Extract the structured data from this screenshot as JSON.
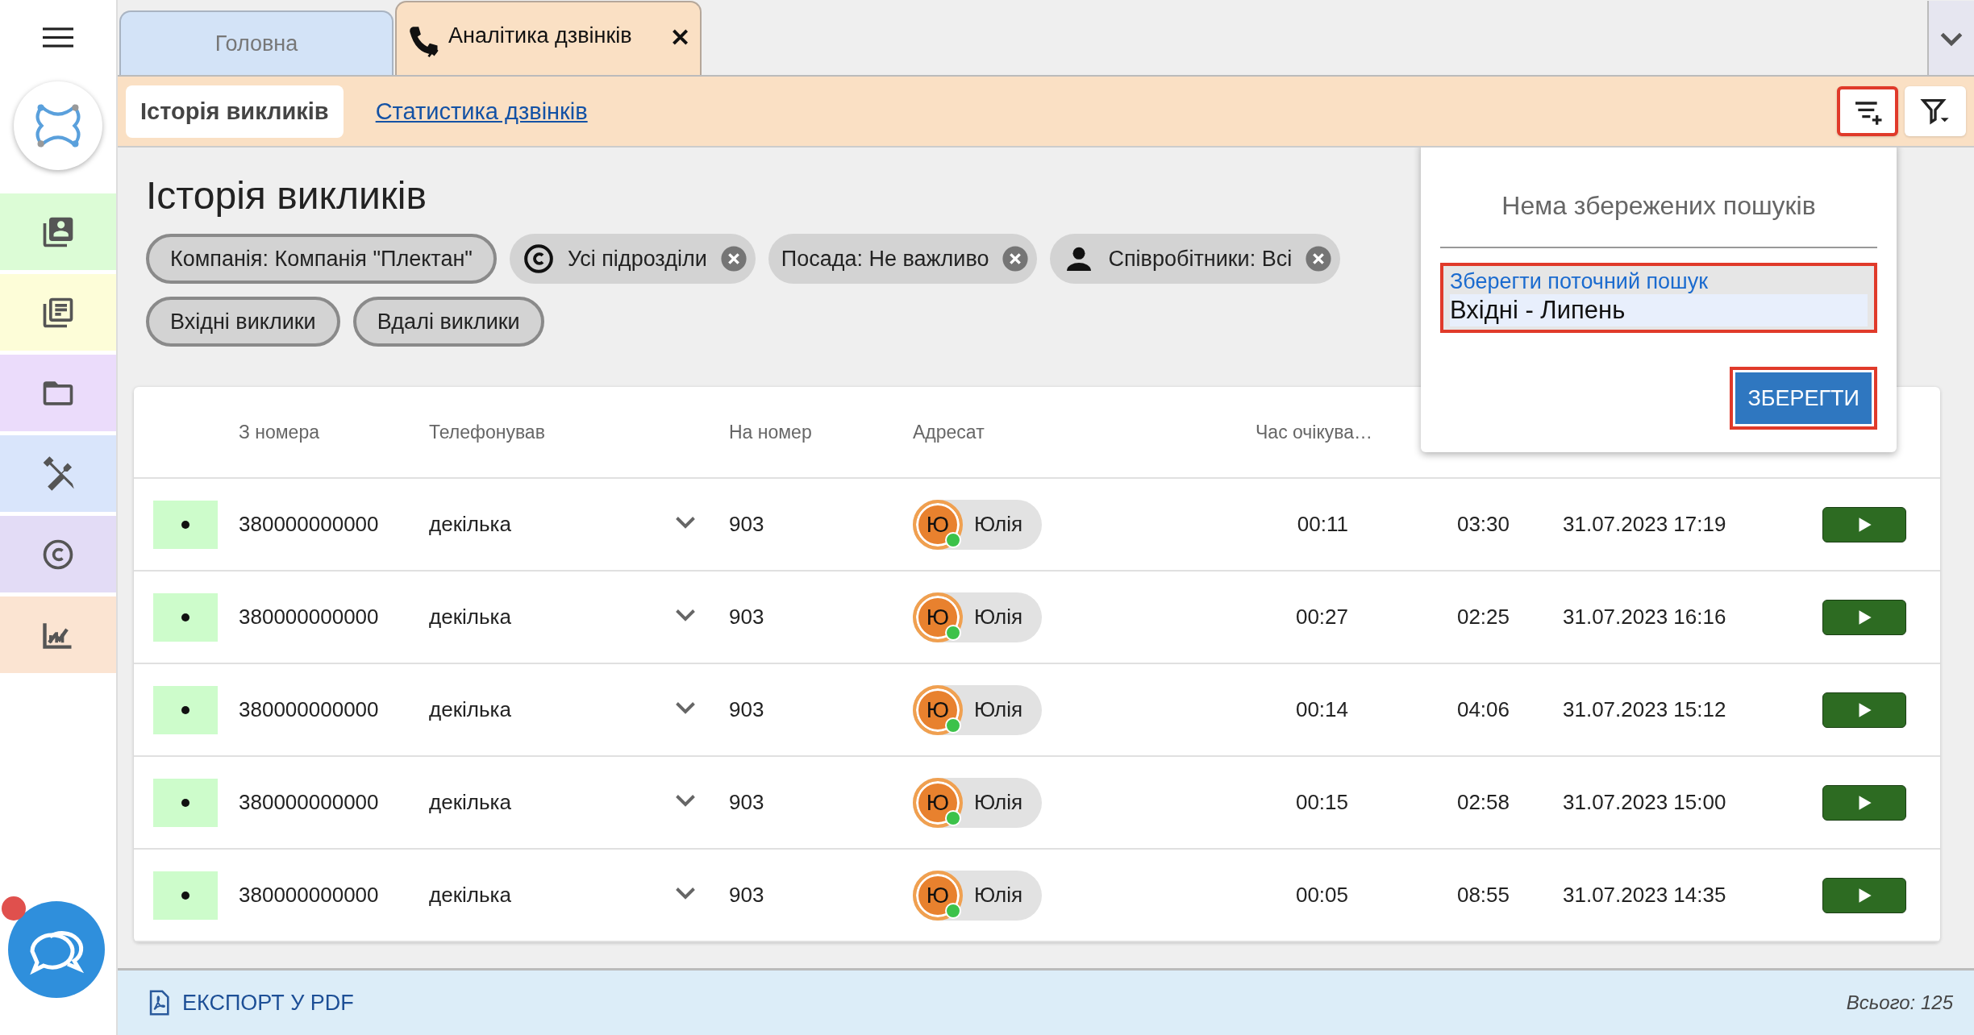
{
  "sidebar": {
    "items": [
      {
        "kind": "contacts",
        "color": "#dcfcd6"
      },
      {
        "kind": "news",
        "color": "#fdfdd8"
      },
      {
        "kind": "folder",
        "color": "#ebdcfb"
      },
      {
        "kind": "tools",
        "color": "#d9e5fb"
      },
      {
        "kind": "copyright",
        "color": "#e3dcf6"
      },
      {
        "kind": "chart",
        "color": "#fbe4d2"
      }
    ],
    "chat": {
      "unread": true
    }
  },
  "tabs": [
    {
      "label": "Головна",
      "selected": false,
      "closable": false
    },
    {
      "label": "Аналітика дзвінків",
      "selected": true,
      "closable": true,
      "close": "✕"
    }
  ],
  "subtabs": [
    {
      "label": "Історія викликів",
      "selected": true
    },
    {
      "label": "Статистика дзвінків",
      "selected": false
    }
  ],
  "toolbar": [
    {
      "kind": "add",
      "highlighted": true
    },
    {
      "kind": "menu",
      "highlighted": false
    }
  ],
  "title": "Історія викликів",
  "filters": [
    {
      "label": "Компанія: Компанія \"Плектан\"",
      "kind": "plain",
      "removable": false
    },
    {
      "label": "Усі підрозділи",
      "kind": "copyright",
      "removable": true
    },
    {
      "label": "Посада: Не важливо",
      "kind": "plain",
      "removable": true
    },
    {
      "label": "Співробітники: Всі",
      "kind": "person",
      "removable": true
    },
    {
      "label": "Вхідні виклики",
      "kind": "plain",
      "removable": false
    },
    {
      "label": "Вдалі виклики",
      "kind": "plain",
      "removable": false
    }
  ],
  "table": {
    "columns": [
      "З номера",
      "Телефонував",
      "На номер",
      "Адресат",
      "Час очікува…"
    ],
    "rows": [
      {
        "from": "380000000000",
        "caller": "декілька",
        "to": "903",
        "initial": "Ю",
        "addressee": "Юлія",
        "online": true,
        "wait": "00:11",
        "duration": "03:30",
        "date": "31.07.2023 17:19"
      },
      {
        "from": "380000000000",
        "caller": "декілька",
        "to": "903",
        "initial": "Ю",
        "addressee": "Юлія",
        "online": true,
        "wait": "00:27",
        "duration": "02:25",
        "date": "31.07.2023 16:16"
      },
      {
        "from": "380000000000",
        "caller": "декілька",
        "to": "903",
        "initial": "Ю",
        "addressee": "Юлія",
        "online": true,
        "wait": "00:14",
        "duration": "04:06",
        "date": "31.07.2023 15:12"
      },
      {
        "from": "380000000000",
        "caller": "декілька",
        "to": "903",
        "initial": "Ю",
        "addressee": "Юлія",
        "online": true,
        "wait": "00:15",
        "duration": "02:58",
        "date": "31.07.2023 15:00"
      },
      {
        "from": "380000000000",
        "caller": "декілька",
        "to": "903",
        "initial": "Ю",
        "addressee": "Юлія",
        "online": true,
        "wait": "00:05",
        "duration": "08:55",
        "date": "31.07.2023 14:35"
      }
    ]
  },
  "popup": {
    "empty_message": "Нема збережених пошуків",
    "field": {
      "label": "Зберегти поточний пошук",
      "value": "Вхідні - Липень",
      "highlighted": true
    },
    "save": {
      "label": "ЗБЕРЕГТИ",
      "highlighted": true
    }
  },
  "footer": {
    "export": "ЕКСПОРТ У PDF",
    "total": "Всього: 125"
  }
}
